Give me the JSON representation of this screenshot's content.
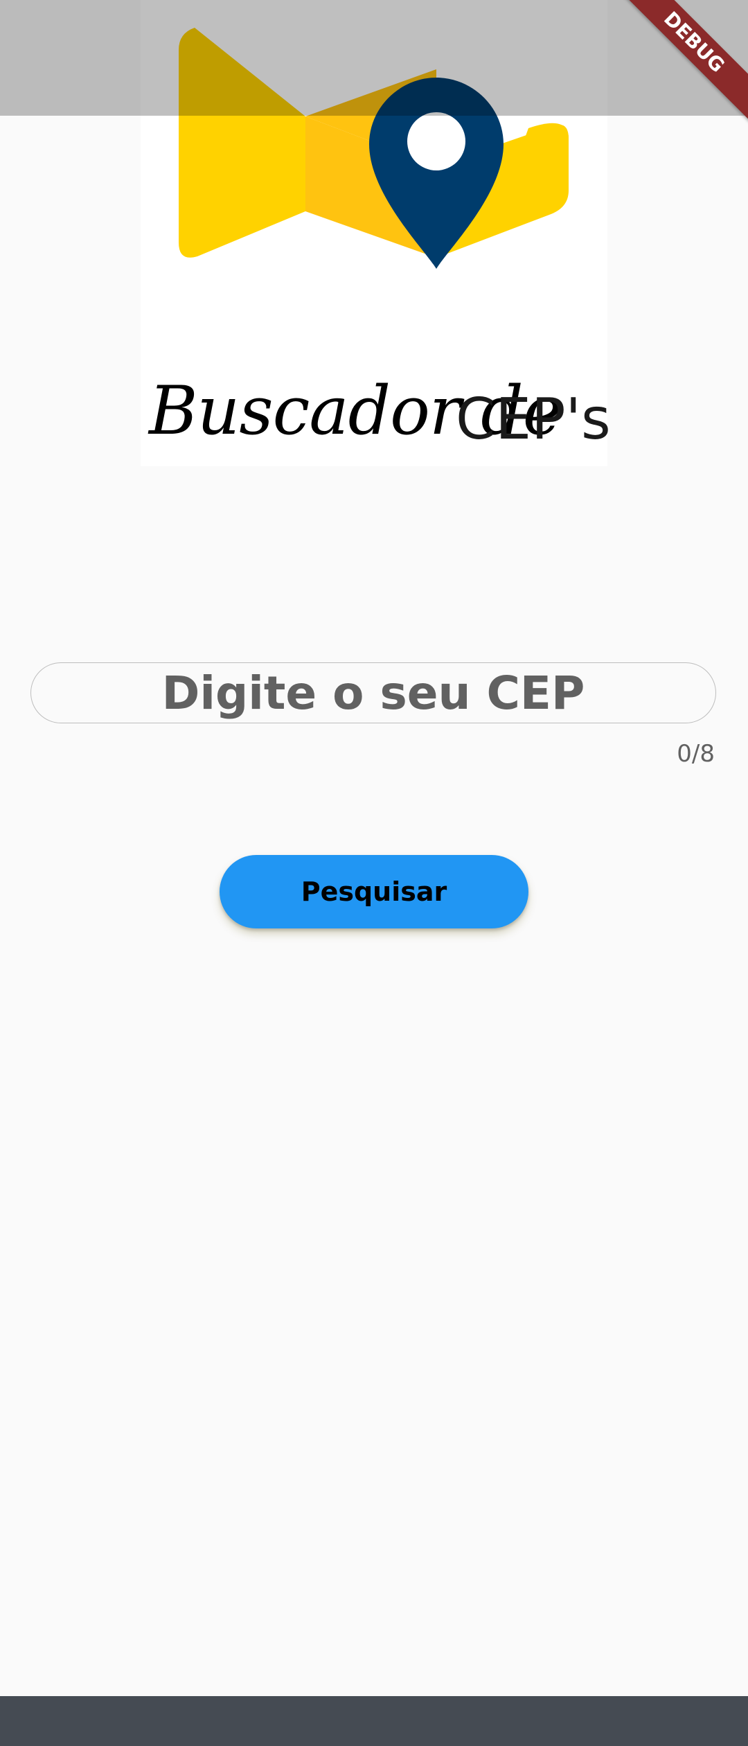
{
  "logo": {
    "script_text": "Buscador de",
    "cep_text": "CEP's",
    "map_icon": "folded-map-with-location-pin-icon"
  },
  "debug_banner": {
    "label": "DEBUG"
  },
  "cep_input": {
    "placeholder": "Digite o seu CEP",
    "value": "",
    "counter": "0/8"
  },
  "search_button": {
    "label": "Pesquisar"
  },
  "colors": {
    "background": "#fafafa",
    "button": "#2196f3",
    "map_yellow": "#ffd200",
    "map_fold": "#ffc310",
    "pin_navy": "#003c6c",
    "nav_bar": "#454b53"
  }
}
